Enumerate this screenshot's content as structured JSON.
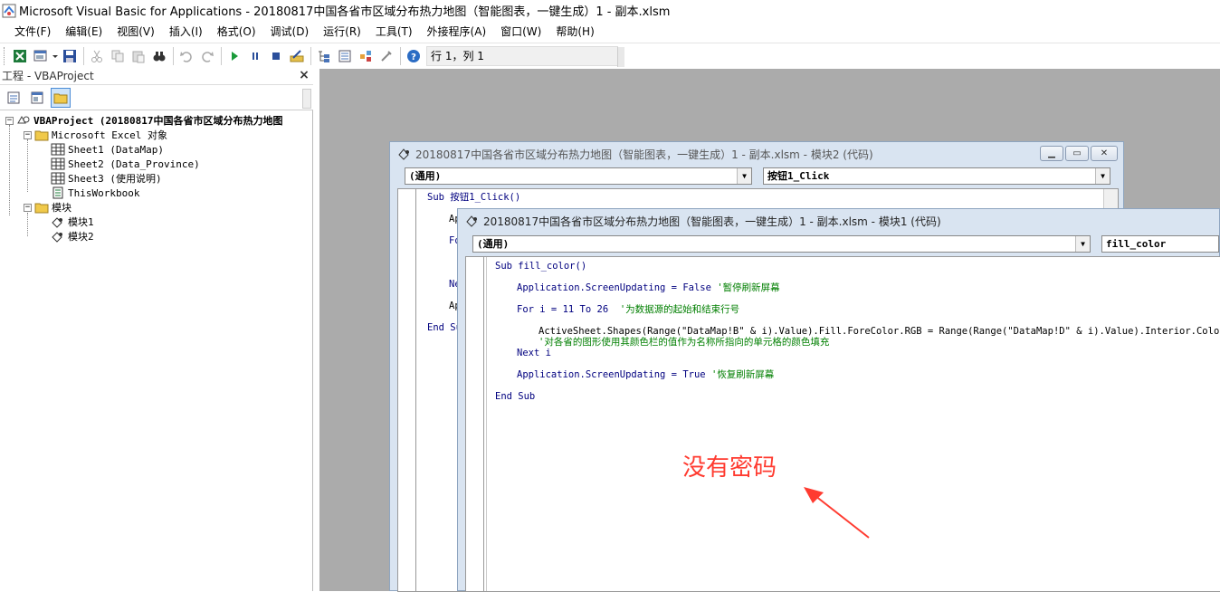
{
  "window": {
    "title": "Microsoft Visual Basic for Applications - 20180817中国各省市区域分布热力地图（智能图表，一键生成）1 - 副本.xlsm"
  },
  "menu": [
    "文件(F)",
    "编辑(E)",
    "视图(V)",
    "插入(I)",
    "格式(O)",
    "调试(D)",
    "运行(R)",
    "工具(T)",
    "外接程序(A)",
    "窗口(W)",
    "帮助(H)"
  ],
  "toolbar": {
    "icons": [
      "excel-icon",
      "insert-module-icon",
      "save-icon",
      "cut-icon",
      "copy-icon",
      "paste-icon",
      "find-icon",
      "undo-icon",
      "redo-icon",
      "run-icon",
      "break-icon",
      "reset-icon",
      "design-mode-icon",
      "project-explorer-icon",
      "properties-icon",
      "object-browser-icon",
      "toolbox-icon",
      "help-icon"
    ],
    "position": "行 1，列 1"
  },
  "project": {
    "header": "工程 - VBAProject",
    "close_label": "×",
    "tree": {
      "root": "VBAProject (20180817中国各省市区域分布热力地图",
      "excel_objects": "Microsoft Excel 对象",
      "sheets": [
        "Sheet1 (DataMap)",
        "Sheet2 (Data_Province)",
        "Sheet3 (使用说明)",
        "ThisWorkbook"
      ],
      "modules_folder": "模块",
      "modules": [
        "模块1",
        "模块2"
      ]
    }
  },
  "back_window": {
    "title": "20180817中国各省市区域分布热力地图（智能图表，一键生成）1 - 副本.xlsm - 模块2 (代码)",
    "object_combo": "(通用)",
    "proc_combo": "按钮1_Click",
    "code_lines": [
      "Sub 按钮1_Click()",
      "Ap",
      "Fo",
      "Ne",
      "Ap",
      "End Su"
    ]
  },
  "front_window": {
    "title": "20180817中国各省市区域分布热力地图（智能图表，一键生成）1 - 副本.xlsm - 模块1 (代码)",
    "object_combo": "(通用)",
    "proc_combo": "fill_color",
    "code": {
      "l1": "Sub fill_color()",
      "l2_code": "Application.ScreenUpdating = False",
      "l2_comment": "'暂停刷新屏幕",
      "l3_code": "For i = 11 To 26",
      "l3_comment": "'为数据源的起始和结束行号",
      "l4_code": "ActiveSheet.Shapes(Range(\"DataMap!B\" & i).Value).Fill.ForeColor.RGB = Range(Range(\"DataMap!D\" & i).Value).Interior.Color",
      "l5_comment": "'对各省的图形使用其颜色栏的值作为名称所指向的单元格的颜色填充",
      "l6": "Next i",
      "l7_code": "Application.ScreenUpdating = True",
      "l7_comment": "'恢复刷新屏幕",
      "l8": "End Sub"
    }
  },
  "annotation": {
    "text": "没有密码",
    "color": "#ff3b30"
  }
}
